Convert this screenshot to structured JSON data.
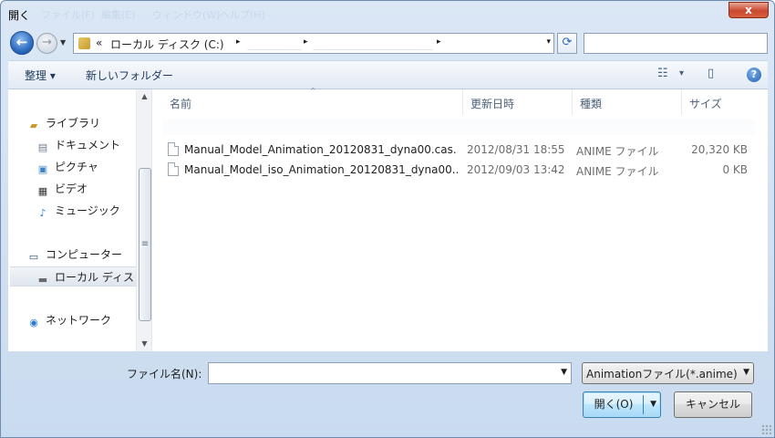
{
  "window": {
    "title": "開く",
    "ghost_menu": [
      "ファイル(F)",
      "編集(E)",
      "ウィンドウ(W)",
      "ヘルプ(H)"
    ],
    "close_label": "x"
  },
  "address": {
    "chevron": "«",
    "segment": "ローカル ディスク (C:)",
    "dropdown_arrow": "▾",
    "breadcrumb_arrow": "▸"
  },
  "search": {
    "placeholder": ""
  },
  "toolbar": {
    "organize": "整理 ▾",
    "new_folder": "新しいフォルダー",
    "view_icon": "☷",
    "view_dropdown": "▾",
    "preview_icon": "▯",
    "help_label": "?"
  },
  "nav": {
    "libraries": "ライブラリ",
    "documents": "ドキュメント",
    "pictures": "ピクチャ",
    "videos": "ビデオ",
    "music": "ミュージック",
    "computer": "コンピューター",
    "local_disk": "ローカル ディス",
    "network": "ネットワーク"
  },
  "columns": {
    "name": "名前",
    "date": "更新日時",
    "type": "種類",
    "size": "サイズ",
    "sort_indicator": "^"
  },
  "files": [
    {
      "name": "Manual_Model_Animation_20120831_dyna00.cas...",
      "date": "2012/08/31 18:55",
      "type": "ANIME ファイル",
      "size": "20,320 KB"
    },
    {
      "name": "Manual_Model_iso_Animation_20120831_dyna00...",
      "date": "2012/09/03 13:42",
      "type": "ANIME ファイル",
      "size": "0 KB"
    }
  ],
  "bottom": {
    "filename_label": "ファイル名(N):",
    "filename_value": "",
    "filter_value": "Animationファイル(*.anime)",
    "open_button": "開く(O)",
    "cancel_button": "キャンセル"
  },
  "icons": {
    "back": "back-arrow-icon",
    "forward": "forward-arrow-icon",
    "folder": "folder-icon",
    "refresh": "refresh-icon",
    "help": "help-icon",
    "file": "document-icon"
  },
  "colors": {
    "accent": "#2d6cc0",
    "frame": "#c9dbef",
    "close": "#c9492f"
  }
}
